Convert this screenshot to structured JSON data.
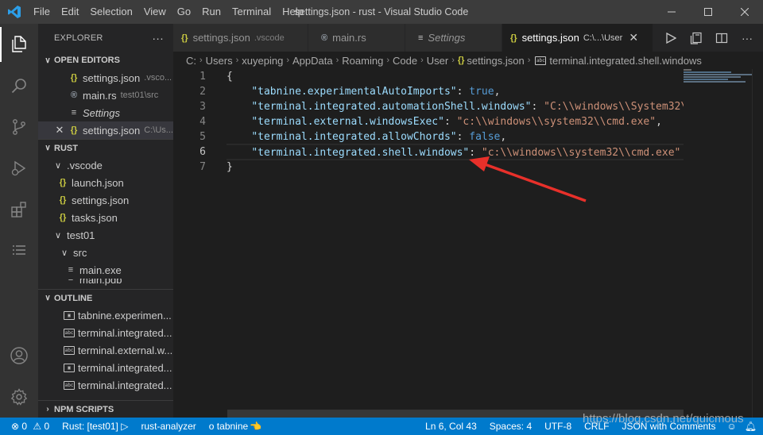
{
  "window": {
    "title": "settings.json - rust - Visual Studio Code",
    "menu": [
      "File",
      "Edit",
      "Selection",
      "View",
      "Go",
      "Run",
      "Terminal",
      "Help"
    ]
  },
  "activity_bar": {
    "items": [
      "explorer-icon",
      "search-icon",
      "source-control-icon",
      "run-debug-icon",
      "extensions-icon",
      "list-icon"
    ],
    "bottom": [
      "account-icon",
      "gear-icon"
    ]
  },
  "sidebar": {
    "title": "EXPLORER",
    "more": "···",
    "open_editors": {
      "label": "OPEN EDITORS",
      "items": [
        {
          "icon": "{}",
          "name": "settings.json",
          "desc": ".vsco..."
        },
        {
          "icon": "®",
          "name": "main.rs",
          "desc": "test01\\src"
        },
        {
          "icon": "≡",
          "name": "Settings",
          "desc": ""
        },
        {
          "icon": "{}",
          "name": "settings.json",
          "desc": "C:\\Us..."
        }
      ]
    },
    "rust": {
      "label": "RUST",
      "items": [
        {
          "chev": "∨",
          "icon": "",
          "name": ".vscode"
        },
        {
          "chev": "",
          "icon": "{}",
          "name": "launch.json"
        },
        {
          "chev": "",
          "icon": "{}",
          "name": "settings.json"
        },
        {
          "chev": "",
          "icon": "{}",
          "name": "tasks.json"
        },
        {
          "chev": "∨",
          "icon": "",
          "name": "test01"
        },
        {
          "chev": "∨",
          "icon": "",
          "name": "src"
        },
        {
          "chev": "",
          "icon": "≡",
          "name": "main.exe"
        },
        {
          "chev": "",
          "icon": "≡",
          "name": "main.pdb"
        }
      ]
    },
    "outline": {
      "label": "OUTLINE",
      "items": [
        "tabnine.experimen...",
        "terminal.integrated...",
        "terminal.external.w...",
        "terminal.integrated...",
        "terminal.integrated..."
      ]
    },
    "npm_scripts": {
      "label": "NPM SCRIPTS"
    }
  },
  "tabs": [
    {
      "icon": "{}",
      "label": "settings.json",
      "desc": ".vscode",
      "italic": false
    },
    {
      "icon": "®",
      "label": "main.rs",
      "desc": "",
      "italic": false
    },
    {
      "icon": "≡",
      "label": "Settings",
      "desc": "",
      "italic": true
    },
    {
      "icon": "{}",
      "label": "settings.json",
      "desc": "C:\\...\\User",
      "italic": false,
      "active": true,
      "close": "✕"
    }
  ],
  "breadcrumb": [
    "C:",
    "Users",
    "xuyeping",
    "AppData",
    "Roaming",
    "Code",
    "User",
    "settings.json",
    "terminal.integrated.shell.windows"
  ],
  "editor": {
    "current_line": 6,
    "line_numbers": [
      "1",
      "2",
      "3",
      "4",
      "5",
      "6",
      "7"
    ],
    "lines": [
      [
        {
          "t": "{",
          "c": "p"
        }
      ],
      [
        {
          "t": "    ",
          "c": "p"
        },
        {
          "t": "\"tabnine.experimentalAutoImports\"",
          "c": "k"
        },
        {
          "t": ": ",
          "c": "p"
        },
        {
          "t": "true",
          "c": "b"
        },
        {
          "t": ",",
          "c": "p"
        }
      ],
      [
        {
          "t": "    ",
          "c": "p"
        },
        {
          "t": "\"terminal.integrated.automationShell.windows\"",
          "c": "k"
        },
        {
          "t": ": ",
          "c": "p"
        },
        {
          "t": "\"C:\\\\windows\\\\System32\\\\",
          "c": "s"
        }
      ],
      [
        {
          "t": "    ",
          "c": "p"
        },
        {
          "t": "\"terminal.external.windowsExec\"",
          "c": "k"
        },
        {
          "t": ": ",
          "c": "p"
        },
        {
          "t": "\"c:\\\\windows\\\\system32\\\\cmd.exe\"",
          "c": "s"
        },
        {
          "t": ",",
          "c": "p"
        }
      ],
      [
        {
          "t": "    ",
          "c": "p"
        },
        {
          "t": "\"terminal.integrated.allowChords\"",
          "c": "k"
        },
        {
          "t": ": ",
          "c": "p"
        },
        {
          "t": "false",
          "c": "b"
        },
        {
          "t": ",",
          "c": "p"
        }
      ],
      [
        {
          "t": "    ",
          "c": "p"
        },
        {
          "t": "\"terminal.integrated.shell.windows\"",
          "c": "k"
        },
        {
          "t": ": ",
          "c": "p"
        },
        {
          "t": "\"c:\\\\windows\\\\system32\\\\cmd.exe\"",
          "c": "s"
        }
      ],
      [
        {
          "t": "}",
          "c": "p"
        }
      ]
    ]
  },
  "statusbar": {
    "errors": "⊗ 0",
    "warnings": "⚠ 0",
    "run": "Rust: [test01] ▷",
    "analyzer": "rust-analyzer",
    "tabnine": "o tabnine",
    "position": "Ln 6, Col 43",
    "spaces": "Spaces: 4",
    "encoding": "UTF-8",
    "eol": "CRLF",
    "language": "JSON with Comments"
  },
  "watermark": "https://blog.csdn.net/quicmous",
  "colors": {
    "accent": "#007acc",
    "arrow": "#e8302a",
    "json_icon": "#cbcb41",
    "key": "#9cdcfe",
    "string": "#ce9178",
    "keyword": "#569cd6"
  }
}
